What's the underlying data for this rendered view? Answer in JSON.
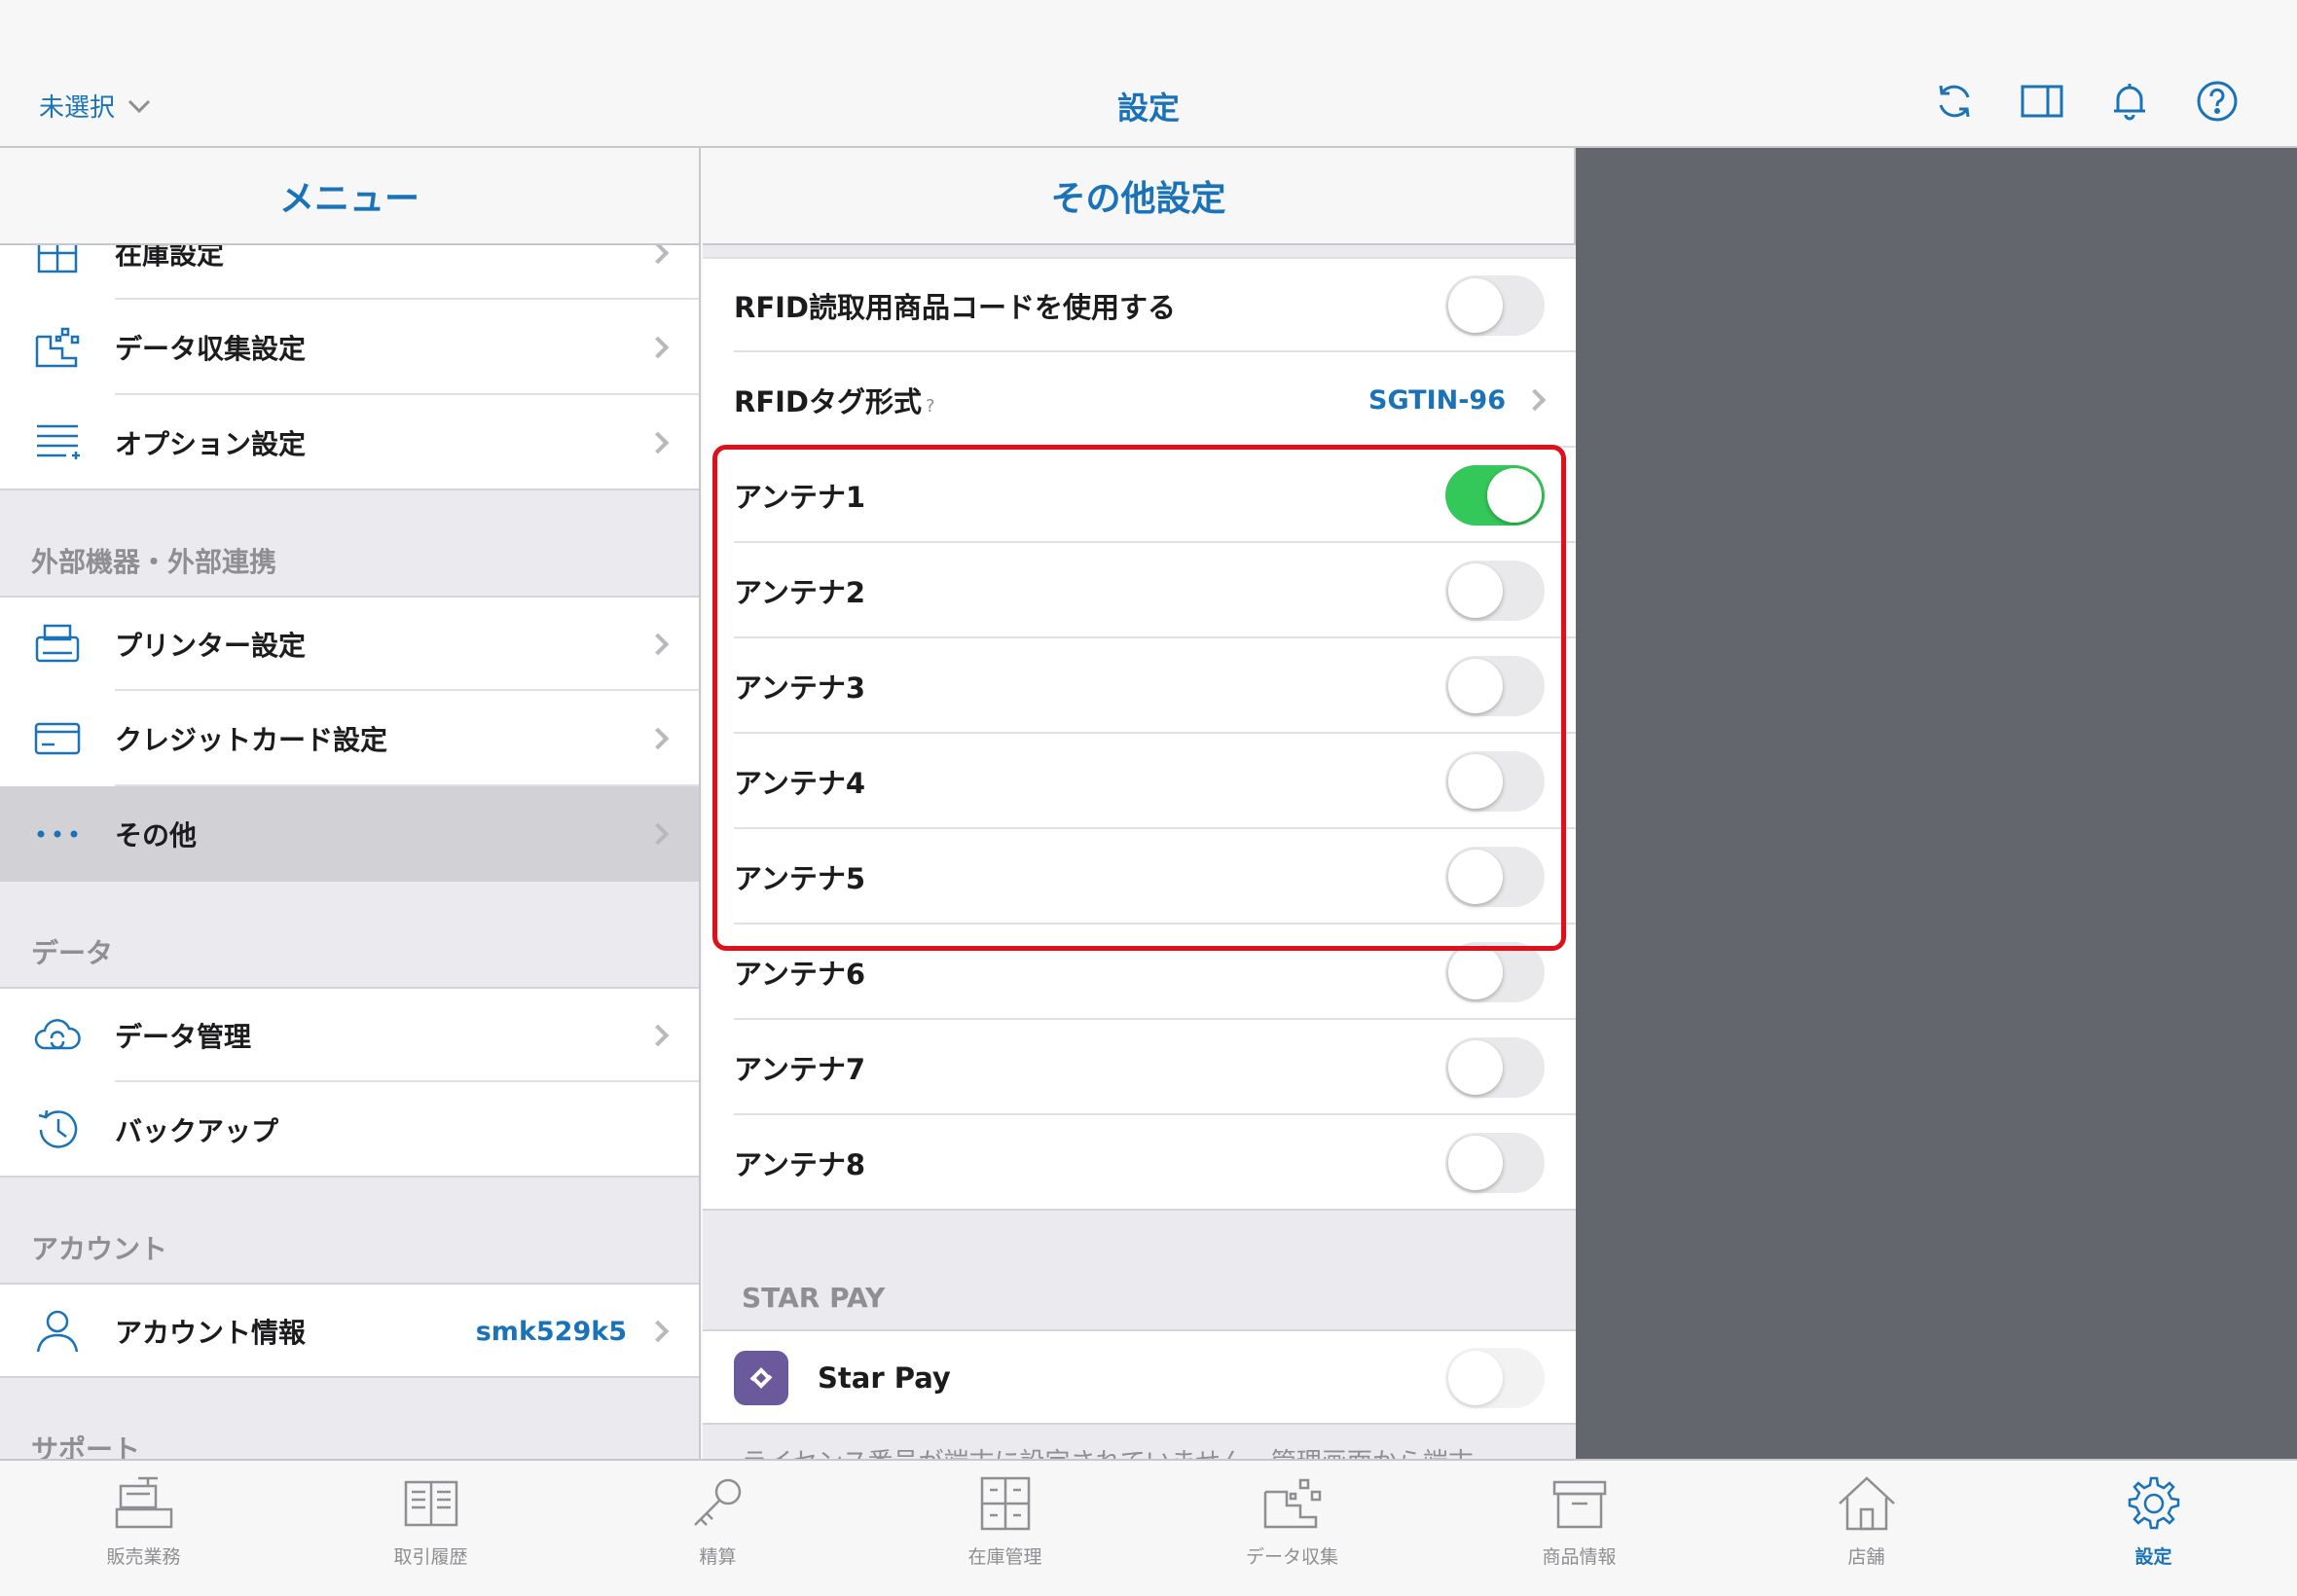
{
  "topbar": {
    "store_select": "未選択",
    "title": "設定"
  },
  "menu": {
    "title": "メニュー",
    "items_top": [
      {
        "label": "在庫設定",
        "icon": "inventory-grid-icon"
      },
      {
        "label": "データ収集設定",
        "icon": "data-collection-icon"
      },
      {
        "label": "オプション設定",
        "icon": "options-list-icon"
      }
    ],
    "section_external": "外部機器・外部連携",
    "items_external": [
      {
        "label": "プリンター設定",
        "icon": "printer-icon"
      },
      {
        "label": "クレジットカード設定",
        "icon": "credit-card-icon"
      },
      {
        "label": "その他",
        "icon": "more-dots-icon"
      }
    ],
    "section_data": "データ",
    "items_data": [
      {
        "label": "データ管理",
        "icon": "cloud-sync-icon"
      },
      {
        "label": "バックアップ",
        "icon": "history-clock-icon"
      }
    ],
    "section_account": "アカウント",
    "account": {
      "label": "アカウント情報",
      "value": "smk529k5",
      "icon": "person-icon"
    },
    "section_support": "サポート"
  },
  "detail": {
    "title": "その他設定",
    "rfid_code_label": "RFID読取用商品コードを使用する",
    "rfid_code_on": false,
    "rfid_tag_label": "RFIDタグ形式",
    "rfid_tag_help": "?",
    "rfid_tag_value": "SGTIN-96",
    "antennas": [
      {
        "label": "アンテナ1",
        "on": true
      },
      {
        "label": "アンテナ2",
        "on": false
      },
      {
        "label": "アンテナ3",
        "on": false
      },
      {
        "label": "アンテナ4",
        "on": false
      },
      {
        "label": "アンテナ5",
        "on": false
      },
      {
        "label": "アンテナ6",
        "on": false
      },
      {
        "label": "アンテナ7",
        "on": false
      },
      {
        "label": "アンテナ8",
        "on": false
      }
    ],
    "starpay_section": "STAR PAY",
    "starpay_label": "Star Pay",
    "starpay_on": false,
    "starpay_note": "ライセンス番号が端末に設定されていません。管理画面から端末"
  },
  "tabbar": [
    {
      "label": "販売業務",
      "icon": "register-icon",
      "active": false
    },
    {
      "label": "取引履歴",
      "icon": "book-icon",
      "active": false
    },
    {
      "label": "精算",
      "icon": "key-icon",
      "active": false
    },
    {
      "label": "在庫管理",
      "icon": "cabinet-icon",
      "active": false
    },
    {
      "label": "データ収集",
      "icon": "data-collect-icon",
      "active": false
    },
    {
      "label": "商品情報",
      "icon": "box-icon",
      "active": false
    },
    {
      "label": "店舗",
      "icon": "house-icon",
      "active": false
    },
    {
      "label": "設定",
      "icon": "gear-icon",
      "active": true
    }
  ],
  "colors": {
    "accent": "#1a73b8",
    "toggle_on": "#34c759",
    "highlight": "#e0101a"
  }
}
